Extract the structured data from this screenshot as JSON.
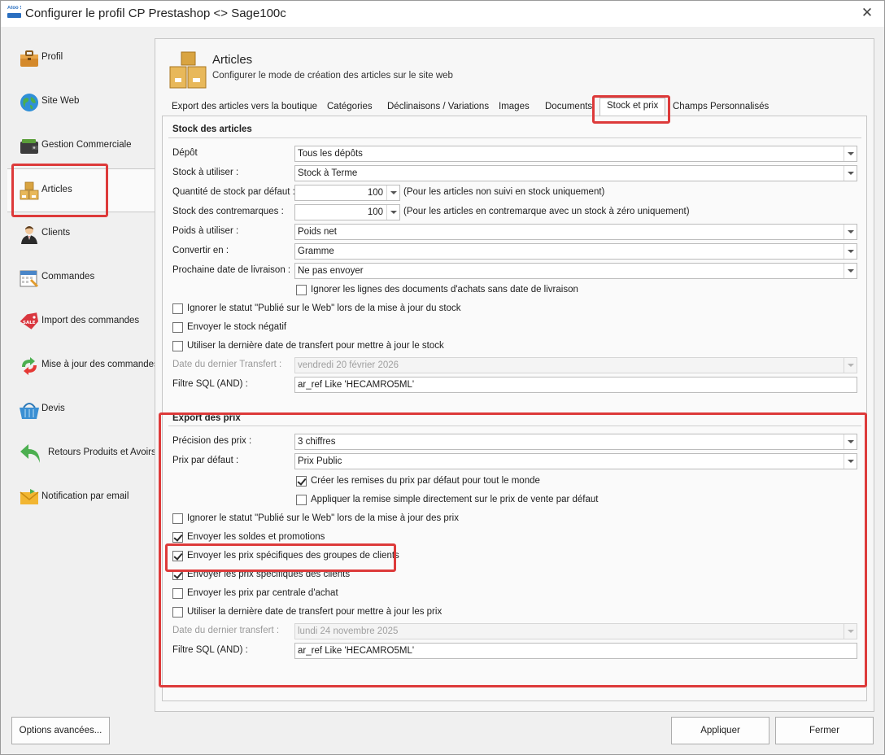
{
  "window": {
    "app_logo_text": "Atoo Sync",
    "title": "Configurer le profil CP Prestashop <> Sage100c",
    "close_glyph": "✕"
  },
  "sidebar": {
    "items": [
      {
        "label": "Profil",
        "icon": "briefcase-icon"
      },
      {
        "label": "Site Web",
        "icon": "globe-icon"
      },
      {
        "label": "Gestion Commerciale",
        "icon": "wallet-icon"
      },
      {
        "label": "Articles",
        "icon": "boxes-icon",
        "active": true
      },
      {
        "label": "Clients",
        "icon": "user-icon"
      },
      {
        "label": "Commandes",
        "icon": "calendar-icon"
      },
      {
        "label": "Import des commandes",
        "icon": "sale-tag-icon"
      },
      {
        "label": "Mise à jour des commandes",
        "icon": "refresh-arrows-icon"
      },
      {
        "label": "Devis",
        "icon": "basket-icon"
      },
      {
        "label": "Retours Produits et Avoirs",
        "icon": "return-arrow-icon"
      },
      {
        "label": "Notification par email",
        "icon": "envelope-icon"
      }
    ]
  },
  "header": {
    "title": "Articles",
    "subtitle": "Configurer le mode de création des articles sur le site web"
  },
  "tabs": [
    "Export des articles vers la boutique",
    "Catégories",
    "Déclinaisons / Variations",
    "Images",
    "Documents",
    "Stock et prix",
    "Champs Personnalisés"
  ],
  "active_tab": "Stock et prix",
  "stock": {
    "section_title": "Stock des articles",
    "depot_label": "Dépôt",
    "depot_value": "Tous les dépôts",
    "stock_use_label": "Stock à utiliser :",
    "stock_use_value": "Stock à Terme",
    "qty_default_label": "Quantité de stock par défaut :",
    "qty_default_value": "100",
    "qty_default_note": "(Pour les articles non suivi en stock uniquement)",
    "contremarque_label": "Stock des contremarques :",
    "contremarque_value": "100",
    "contremarque_note": "(Pour les articles en contremarque avec un stock à zéro uniquement)",
    "weight_label": "Poids à utiliser :",
    "weight_value": "Poids net",
    "convert_label": "Convertir en :",
    "convert_value": "Gramme",
    "delivery_label": "Prochaine date de livraison :",
    "delivery_value": "Ne pas envoyer",
    "ignore_lines_label": "Ignorer les lignes des documents d'achats sans date de livraison",
    "ignore_lines_checked": false,
    "ignore_published_label": "Ignorer le statut \"Publié sur le Web\" lors de la mise à jour du stock",
    "ignore_published_checked": false,
    "negative_label": "Envoyer le stock négatif",
    "negative_checked": false,
    "use_last_date_label": "Utiliser la dernière date de transfert pour mettre à jour le stock",
    "use_last_date_checked": false,
    "last_transfer_label": "Date du dernier Transfert :",
    "last_transfer_value": "vendredi 20 février 2026",
    "sql_label": "Filtre SQL (AND) :",
    "sql_value": "ar_ref Like 'HECAMRO5ML'"
  },
  "prices": {
    "section_title": "Export des prix",
    "precision_label": "Précision des prix :",
    "precision_value": "3 chiffres",
    "default_price_label": "Prix par défaut :",
    "default_price_value": "Prix Public",
    "create_discounts_label": "Créer les remises du prix par défaut pour tout le monde",
    "create_discounts_checked": true,
    "simple_discount_label": "Appliquer la remise simple directement sur le prix de vente par défaut",
    "simple_discount_checked": false,
    "ignore_published_label": "Ignorer le statut \"Publié sur le Web\"  lors de la mise à jour des prix",
    "ignore_published_checked": false,
    "sales_label": "Envoyer les soldes et promotions",
    "sales_checked": true,
    "group_prices_label": "Envoyer les prix spécifiques des groupes de clients",
    "group_prices_checked": true,
    "client_prices_label": "Envoyer les prix spécifiques des clients",
    "client_prices_checked": true,
    "central_label": "Envoyer les prix par centrale d'achat",
    "central_checked": false,
    "use_last_date_label": "Utiliser la dernière date de transfert pour mettre à jour les prix",
    "use_last_date_checked": false,
    "last_transfer_label": "Date du dernier transfert :",
    "last_transfer_value": "lundi 24 novembre 2025",
    "sql_label": "Filtre SQL (AND) :",
    "sql_value": "ar_ref Like 'HECAMRO5ML'"
  },
  "footer": {
    "advanced_label": "Options avancées...",
    "apply_label": "Appliquer",
    "close_label": "Fermer"
  },
  "colors": {
    "highlight_red": "#dd3a3a"
  }
}
